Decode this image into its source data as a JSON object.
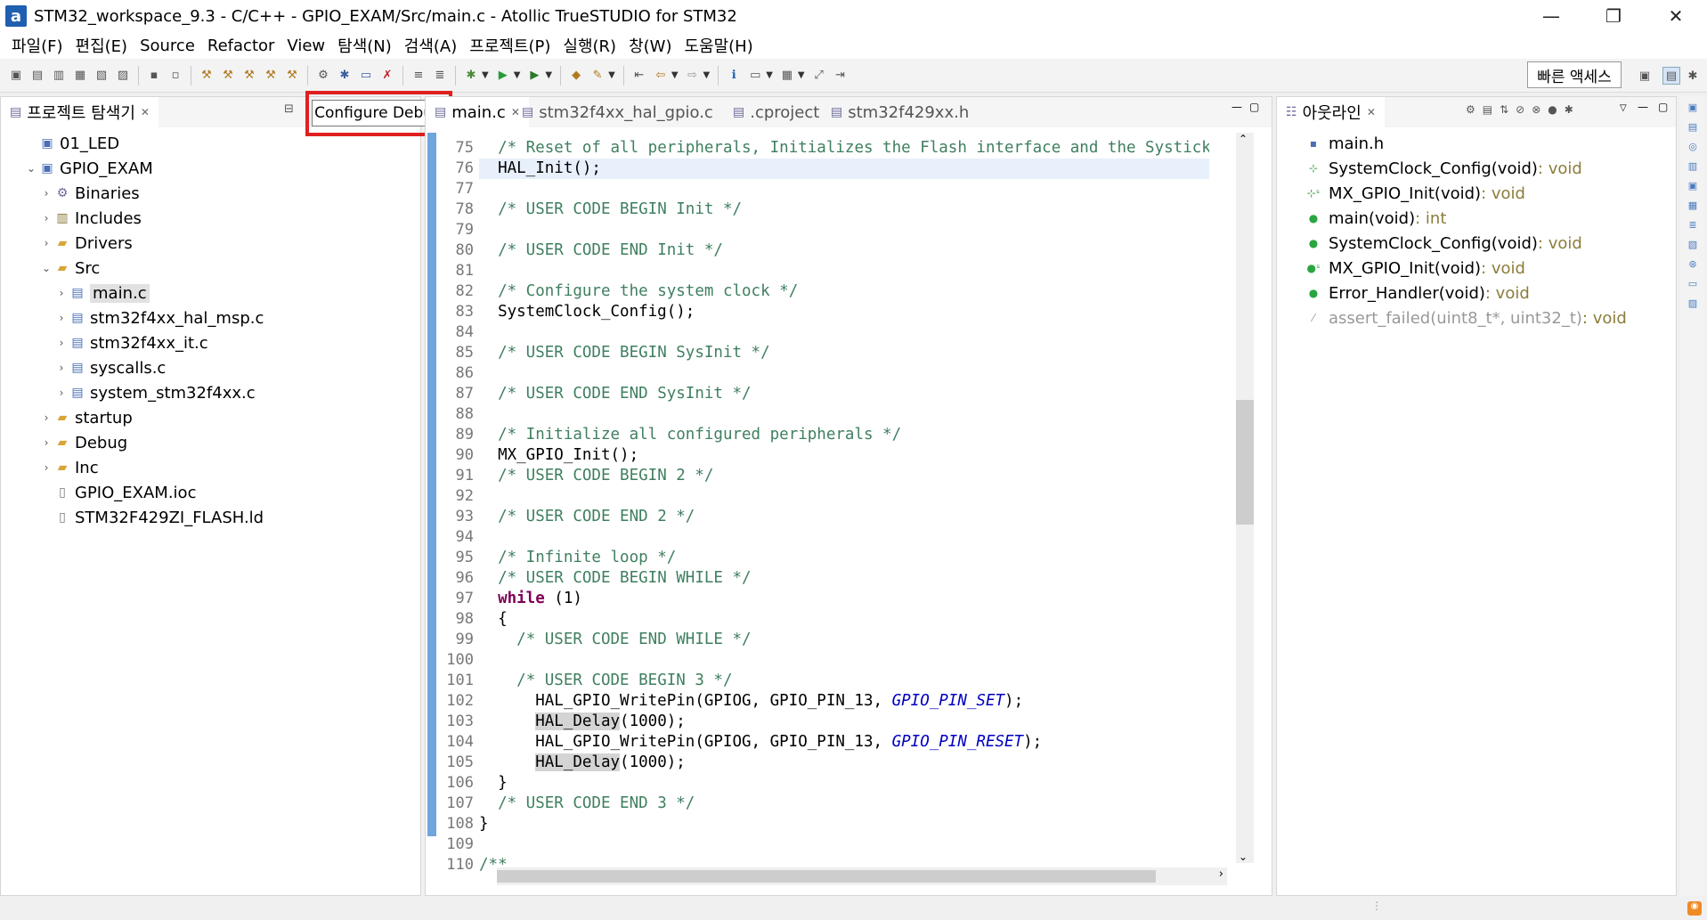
{
  "window": {
    "logo": "a",
    "title": "STM32_workspace_9.3 - C/C++ - GPIO_EXAM/Src/main.c - Atollic TrueSTUDIO for STM32",
    "minimize": "—",
    "maximize": "❐",
    "close": "✕"
  },
  "menu": [
    "파일(F)",
    "편집(E)",
    "Source",
    "Refactor",
    "View",
    "탐색(N)",
    "검색(A)",
    "프로젝트(P)",
    "실행(R)",
    "창(W)",
    "도움말(H)"
  ],
  "toolbar": {
    "quick_access": "빠른 액세스"
  },
  "tooltip": {
    "text": "Configure Debug"
  },
  "explorer": {
    "title": "프로젝트 탐색기",
    "items": [
      {
        "label": "01_LED",
        "depth": 0,
        "twisty": "",
        "icon": "project-icon"
      },
      {
        "label": "GPIO_EXAM",
        "depth": 0,
        "twisty": "expanded",
        "icon": "project-icon"
      },
      {
        "label": "Binaries",
        "depth": 1,
        "twisty": "collapsed",
        "icon": "binaries-icon"
      },
      {
        "label": "Includes",
        "depth": 1,
        "twisty": "collapsed",
        "icon": "includes-icon"
      },
      {
        "label": "Drivers",
        "depth": 1,
        "twisty": "collapsed",
        "icon": "folder-icon"
      },
      {
        "label": "Src",
        "depth": 1,
        "twisty": "expanded",
        "icon": "folder-icon"
      },
      {
        "label": "main.c",
        "depth": 2,
        "twisty": "collapsed",
        "icon": "c-file-icon",
        "selected": true
      },
      {
        "label": "stm32f4xx_hal_msp.c",
        "depth": 2,
        "twisty": "collapsed",
        "icon": "c-file-icon"
      },
      {
        "label": "stm32f4xx_it.c",
        "depth": 2,
        "twisty": "collapsed",
        "icon": "c-file-icon"
      },
      {
        "label": "syscalls.c",
        "depth": 2,
        "twisty": "collapsed",
        "icon": "c-file-icon"
      },
      {
        "label": "system_stm32f4xx.c",
        "depth": 2,
        "twisty": "collapsed",
        "icon": "c-file-icon"
      },
      {
        "label": "startup",
        "depth": 1,
        "twisty": "collapsed",
        "icon": "folder-icon"
      },
      {
        "label": "Debug",
        "depth": 1,
        "twisty": "collapsed",
        "icon": "folder-icon"
      },
      {
        "label": "Inc",
        "depth": 1,
        "twisty": "collapsed",
        "icon": "folder-icon"
      },
      {
        "label": "GPIO_EXAM.ioc",
        "depth": 1,
        "twisty": "",
        "icon": "file-icon"
      },
      {
        "label": "STM32F429ZI_FLASH.ld",
        "depth": 1,
        "twisty": "",
        "icon": "file-icon"
      }
    ]
  },
  "editor": {
    "tabs": [
      {
        "label": "main.c",
        "active": true
      },
      {
        "label": "stm32f4xx_hal_gpio.c",
        "active": false
      },
      {
        "label": ".cproject",
        "active": false
      },
      {
        "label": "stm32f429xx.h",
        "active": false
      }
    ],
    "lines": [
      {
        "n": "75",
        "segs": [
          {
            "t": "  "
          },
          {
            "t": "/* Reset of all peripherals, Initializes the Flash interface and the Systick",
            "c": "cmt"
          }
        ]
      },
      {
        "n": "76",
        "cur": true,
        "segs": [
          {
            "t": "  HAL_Init();"
          }
        ]
      },
      {
        "n": "77",
        "segs": [
          {
            "t": ""
          }
        ]
      },
      {
        "n": "78",
        "segs": [
          {
            "t": "  "
          },
          {
            "t": "/* USER CODE BEGIN Init */",
            "c": "cmt"
          }
        ]
      },
      {
        "n": "79",
        "segs": [
          {
            "t": ""
          }
        ]
      },
      {
        "n": "80",
        "segs": [
          {
            "t": "  "
          },
          {
            "t": "/* USER CODE END Init */",
            "c": "cmt"
          }
        ]
      },
      {
        "n": "81",
        "segs": [
          {
            "t": ""
          }
        ]
      },
      {
        "n": "82",
        "segs": [
          {
            "t": "  "
          },
          {
            "t": "/* Configure the system clock */",
            "c": "cmt"
          }
        ]
      },
      {
        "n": "83",
        "segs": [
          {
            "t": "  SystemClock_Config();"
          }
        ]
      },
      {
        "n": "84",
        "segs": [
          {
            "t": ""
          }
        ]
      },
      {
        "n": "85",
        "segs": [
          {
            "t": "  "
          },
          {
            "t": "/* USER CODE BEGIN SysInit */",
            "c": "cmt"
          }
        ]
      },
      {
        "n": "86",
        "segs": [
          {
            "t": ""
          }
        ]
      },
      {
        "n": "87",
        "segs": [
          {
            "t": "  "
          },
          {
            "t": "/* USER CODE END SysInit */",
            "c": "cmt"
          }
        ]
      },
      {
        "n": "88",
        "segs": [
          {
            "t": ""
          }
        ]
      },
      {
        "n": "89",
        "segs": [
          {
            "t": "  "
          },
          {
            "t": "/* Initialize all configured peripherals */",
            "c": "cmt"
          }
        ]
      },
      {
        "n": "90",
        "segs": [
          {
            "t": "  MX_GPIO_Init();"
          }
        ]
      },
      {
        "n": "91",
        "segs": [
          {
            "t": "  "
          },
          {
            "t": "/* USER CODE BEGIN 2 */",
            "c": "cmt"
          }
        ]
      },
      {
        "n": "92",
        "segs": [
          {
            "t": ""
          }
        ]
      },
      {
        "n": "93",
        "segs": [
          {
            "t": "  "
          },
          {
            "t": "/* USER CODE END 2 */",
            "c": "cmt"
          }
        ]
      },
      {
        "n": "94",
        "segs": [
          {
            "t": ""
          }
        ]
      },
      {
        "n": "95",
        "segs": [
          {
            "t": "  "
          },
          {
            "t": "/* Infinite loop */",
            "c": "cmt"
          }
        ]
      },
      {
        "n": "96",
        "segs": [
          {
            "t": "  "
          },
          {
            "t": "/* USER CODE BEGIN WHILE */",
            "c": "cmt"
          }
        ]
      },
      {
        "n": "97",
        "segs": [
          {
            "t": "  "
          },
          {
            "t": "while",
            "c": "kw"
          },
          {
            "t": " (1)"
          }
        ]
      },
      {
        "n": "98",
        "segs": [
          {
            "t": "  {"
          }
        ]
      },
      {
        "n": "99",
        "segs": [
          {
            "t": "    "
          },
          {
            "t": "/* USER CODE END WHILE */",
            "c": "cmt"
          }
        ]
      },
      {
        "n": "100",
        "segs": [
          {
            "t": ""
          }
        ]
      },
      {
        "n": "101",
        "segs": [
          {
            "t": "    "
          },
          {
            "t": "/* USER CODE BEGIN 3 */",
            "c": "cmt"
          }
        ]
      },
      {
        "n": "102",
        "segs": [
          {
            "t": "      HAL_GPIO_WritePin(GPIOG, GPIO_PIN_13, "
          },
          {
            "t": "GPIO_PIN_SET",
            "c": "mac"
          },
          {
            "t": ");"
          }
        ]
      },
      {
        "n": "103",
        "segs": [
          {
            "t": "      "
          },
          {
            "t": "HAL_Delay",
            "c": "hl"
          },
          {
            "t": "(1000);"
          }
        ]
      },
      {
        "n": "104",
        "segs": [
          {
            "t": "      HAL_GPIO_WritePin(GPIOG, GPIO_PIN_13, "
          },
          {
            "t": "GPIO_PIN_RESET",
            "c": "mac"
          },
          {
            "t": ");"
          }
        ]
      },
      {
        "n": "105",
        "segs": [
          {
            "t": "      "
          },
          {
            "t": "HAL_Delay",
            "c": "hl"
          },
          {
            "t": "(1000);"
          }
        ]
      },
      {
        "n": "106",
        "segs": [
          {
            "t": "  }"
          }
        ]
      },
      {
        "n": "107",
        "segs": [
          {
            "t": "  "
          },
          {
            "t": "/* USER CODE END 3 */",
            "c": "cmt"
          }
        ]
      },
      {
        "n": "108",
        "segs": [
          {
            "t": "}"
          }
        ]
      },
      {
        "n": "109",
        "segs": [
          {
            "t": ""
          }
        ]
      },
      {
        "n": "110",
        "segs": [
          {
            "t": "/**",
            "c": "cmt"
          }
        ]
      }
    ]
  },
  "outline": {
    "title": "아웃라인",
    "items": [
      {
        "name": "main.h",
        "type": "",
        "icon": "include-icon",
        "color": "#4a6fb5"
      },
      {
        "name": "SystemClock_Config(void)",
        "type": " : void",
        "icon": "declaration-icon",
        "color": "#3a9a4a"
      },
      {
        "name": "MX_GPIO_Init(void)",
        "type": " : void",
        "icon": "static-declaration-icon",
        "color": "#3a9a4a"
      },
      {
        "name": "main(void)",
        "type": " : int",
        "icon": "function-icon",
        "color": "#2aa640"
      },
      {
        "name": "SystemClock_Config(void)",
        "type": " : void",
        "icon": "function-icon",
        "color": "#2aa640"
      },
      {
        "name": "MX_GPIO_Init(void)",
        "type": " : void",
        "icon": "static-function-icon",
        "color": "#2aa640"
      },
      {
        "name": "Error_Handler(void)",
        "type": " : void",
        "icon": "function-icon",
        "color": "#2aa640"
      },
      {
        "name": "assert_failed(uint8_t*, uint32_t)",
        "type": " : void",
        "icon": "disabled-function-icon",
        "color": "#9a9a9a",
        "disabled": true
      }
    ]
  }
}
